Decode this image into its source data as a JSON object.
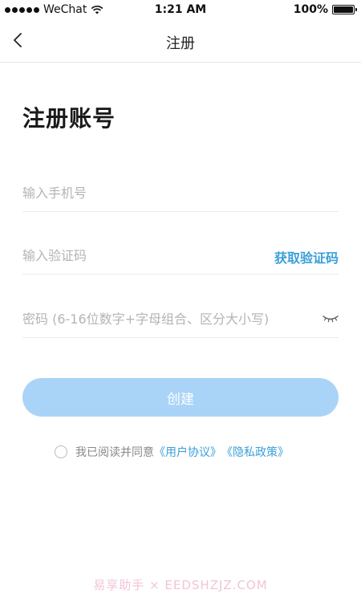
{
  "status_bar": {
    "carrier": "WeChat",
    "time": "1:21 AM",
    "battery": "100%"
  },
  "nav": {
    "title": "注册"
  },
  "page": {
    "heading": "注册账号"
  },
  "form": {
    "phone_placeholder": "输入手机号",
    "code_placeholder": "输入验证码",
    "get_code_label": "获取验证码",
    "password_placeholder": "密码 (6-16位数字+字母组合、区分大小写)",
    "create_label": "创建"
  },
  "agreement": {
    "text": "我已阅读并同意",
    "user_agreement": "《用户协议》",
    "privacy_policy": "《隐私政策》"
  },
  "watermark": {
    "text": "易享助手 × EEDSHZJZ.COM"
  },
  "colors": {
    "accent": "#3a9fd8",
    "button_disabled": "#a9d4f7"
  }
}
